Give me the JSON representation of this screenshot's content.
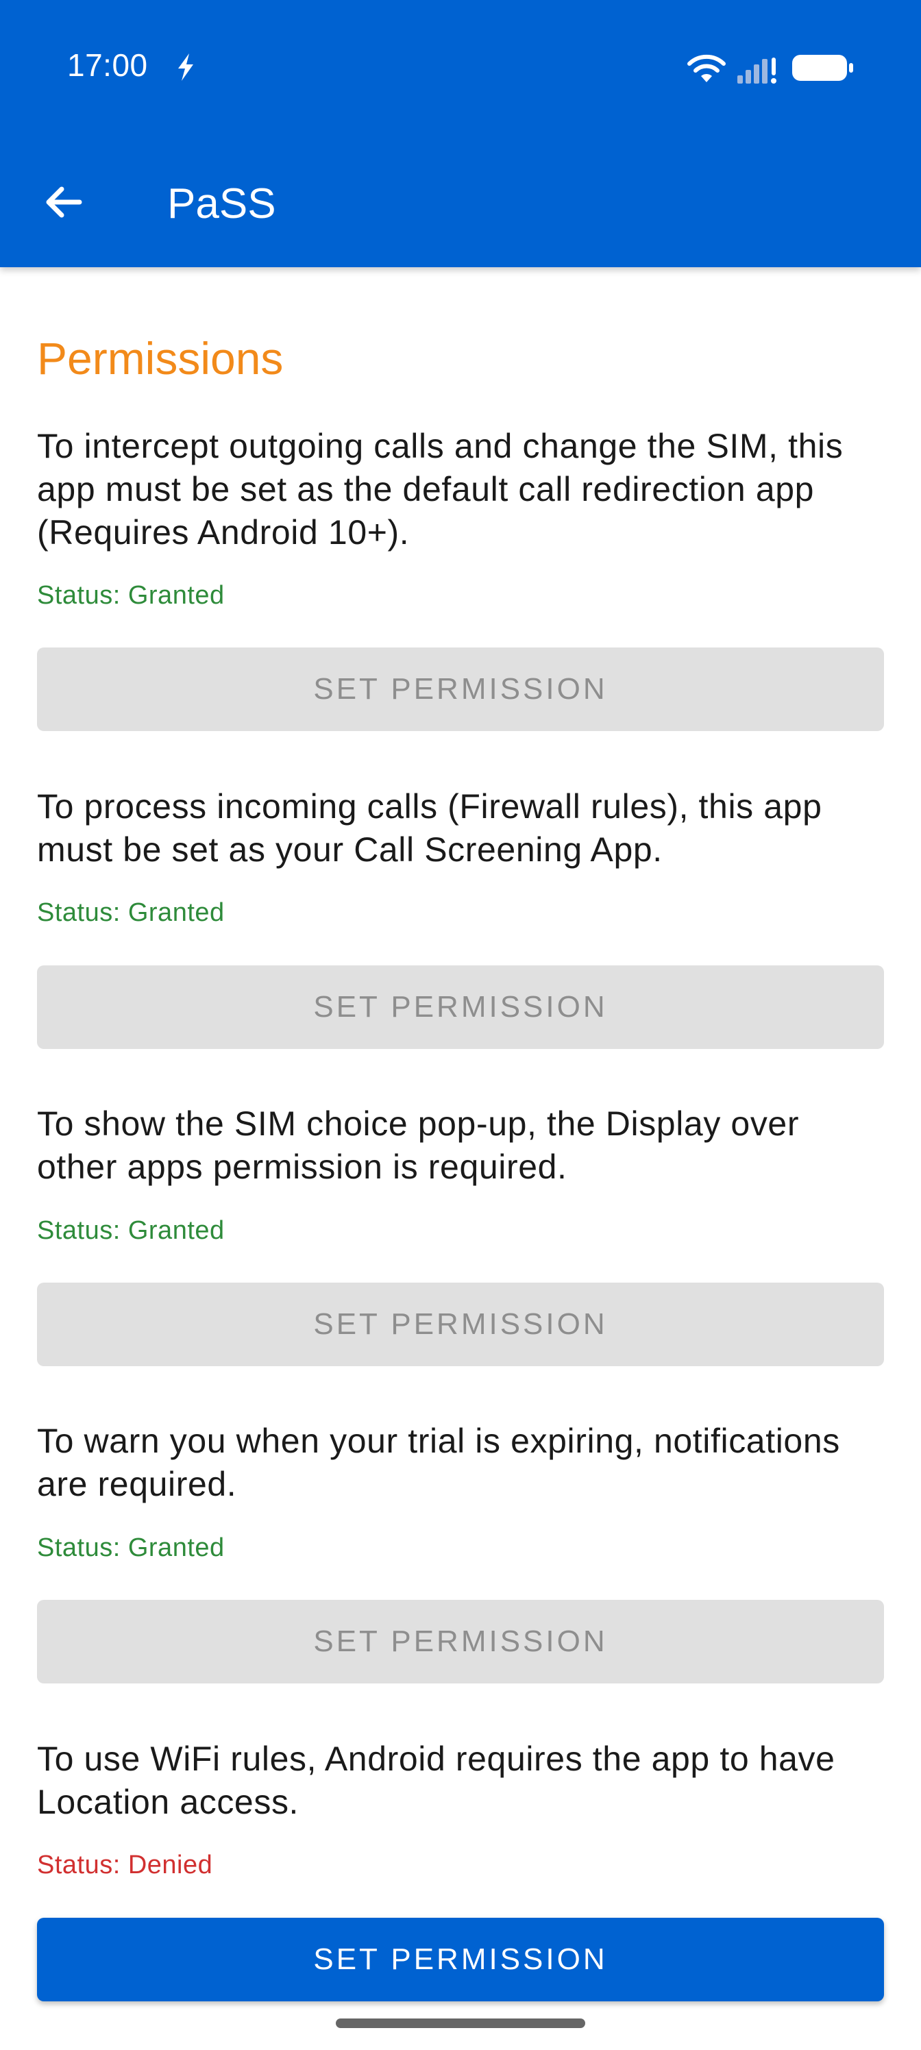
{
  "status_bar": {
    "time": "17:00",
    "icons": [
      "charging-bolt-icon",
      "wifi-icon",
      "signal-icon",
      "battery-icon"
    ]
  },
  "app_bar": {
    "title": "PaSS",
    "back_icon": "arrow-back-icon"
  },
  "permissions": {
    "heading": "Permissions",
    "items": [
      {
        "description": "To intercept outgoing calls and change the SIM, this app must be set as the default call redirection app (Requires Android 10+).",
        "status": "Status: Granted",
        "button_label": "SET PERMISSION",
        "enabled": false
      },
      {
        "description": "To process incoming calls (Firewall rules), this app must be set as your Call Screening App.",
        "status": "Status: Granted",
        "button_label": "SET PERMISSION",
        "enabled": false
      },
      {
        "description": "To show the SIM choice pop-up, the Display over other apps permission is required.",
        "status": "Status: Granted",
        "button_label": "SET PERMISSION",
        "enabled": false
      },
      {
        "description": "To warn you when your trial is expiring, notifications are required.",
        "status": "Status: Granted",
        "button_label": "SET PERMISSION",
        "enabled": false
      },
      {
        "description": "To use WiFi rules, Android requires the app to have Location access.",
        "status": "Status: Denied",
        "button_label": "SET PERMISSION",
        "enabled": true
      }
    ]
  },
  "colors": {
    "primary": "#0062D1",
    "accent": "#F28A1A",
    "granted": "#2E8B3A",
    "denied": "#D13030",
    "disabled_button": "#E0E0E0"
  }
}
